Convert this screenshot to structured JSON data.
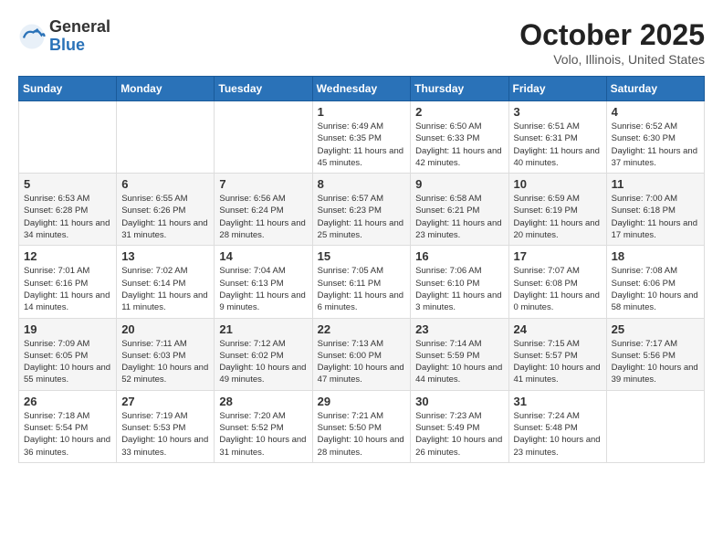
{
  "header": {
    "logo_general": "General",
    "logo_blue": "Blue",
    "month": "October 2025",
    "location": "Volo, Illinois, United States"
  },
  "weekdays": [
    "Sunday",
    "Monday",
    "Tuesday",
    "Wednesday",
    "Thursday",
    "Friday",
    "Saturday"
  ],
  "weeks": [
    [
      {
        "day": "",
        "info": ""
      },
      {
        "day": "",
        "info": ""
      },
      {
        "day": "",
        "info": ""
      },
      {
        "day": "1",
        "info": "Sunrise: 6:49 AM\nSunset: 6:35 PM\nDaylight: 11 hours and 45 minutes."
      },
      {
        "day": "2",
        "info": "Sunrise: 6:50 AM\nSunset: 6:33 PM\nDaylight: 11 hours and 42 minutes."
      },
      {
        "day": "3",
        "info": "Sunrise: 6:51 AM\nSunset: 6:31 PM\nDaylight: 11 hours and 40 minutes."
      },
      {
        "day": "4",
        "info": "Sunrise: 6:52 AM\nSunset: 6:30 PM\nDaylight: 11 hours and 37 minutes."
      }
    ],
    [
      {
        "day": "5",
        "info": "Sunrise: 6:53 AM\nSunset: 6:28 PM\nDaylight: 11 hours and 34 minutes."
      },
      {
        "day": "6",
        "info": "Sunrise: 6:55 AM\nSunset: 6:26 PM\nDaylight: 11 hours and 31 minutes."
      },
      {
        "day": "7",
        "info": "Sunrise: 6:56 AM\nSunset: 6:24 PM\nDaylight: 11 hours and 28 minutes."
      },
      {
        "day": "8",
        "info": "Sunrise: 6:57 AM\nSunset: 6:23 PM\nDaylight: 11 hours and 25 minutes."
      },
      {
        "day": "9",
        "info": "Sunrise: 6:58 AM\nSunset: 6:21 PM\nDaylight: 11 hours and 23 minutes."
      },
      {
        "day": "10",
        "info": "Sunrise: 6:59 AM\nSunset: 6:19 PM\nDaylight: 11 hours and 20 minutes."
      },
      {
        "day": "11",
        "info": "Sunrise: 7:00 AM\nSunset: 6:18 PM\nDaylight: 11 hours and 17 minutes."
      }
    ],
    [
      {
        "day": "12",
        "info": "Sunrise: 7:01 AM\nSunset: 6:16 PM\nDaylight: 11 hours and 14 minutes."
      },
      {
        "day": "13",
        "info": "Sunrise: 7:02 AM\nSunset: 6:14 PM\nDaylight: 11 hours and 11 minutes."
      },
      {
        "day": "14",
        "info": "Sunrise: 7:04 AM\nSunset: 6:13 PM\nDaylight: 11 hours and 9 minutes."
      },
      {
        "day": "15",
        "info": "Sunrise: 7:05 AM\nSunset: 6:11 PM\nDaylight: 11 hours and 6 minutes."
      },
      {
        "day": "16",
        "info": "Sunrise: 7:06 AM\nSunset: 6:10 PM\nDaylight: 11 hours and 3 minutes."
      },
      {
        "day": "17",
        "info": "Sunrise: 7:07 AM\nSunset: 6:08 PM\nDaylight: 11 hours and 0 minutes."
      },
      {
        "day": "18",
        "info": "Sunrise: 7:08 AM\nSunset: 6:06 PM\nDaylight: 10 hours and 58 minutes."
      }
    ],
    [
      {
        "day": "19",
        "info": "Sunrise: 7:09 AM\nSunset: 6:05 PM\nDaylight: 10 hours and 55 minutes."
      },
      {
        "day": "20",
        "info": "Sunrise: 7:11 AM\nSunset: 6:03 PM\nDaylight: 10 hours and 52 minutes."
      },
      {
        "day": "21",
        "info": "Sunrise: 7:12 AM\nSunset: 6:02 PM\nDaylight: 10 hours and 49 minutes."
      },
      {
        "day": "22",
        "info": "Sunrise: 7:13 AM\nSunset: 6:00 PM\nDaylight: 10 hours and 47 minutes."
      },
      {
        "day": "23",
        "info": "Sunrise: 7:14 AM\nSunset: 5:59 PM\nDaylight: 10 hours and 44 minutes."
      },
      {
        "day": "24",
        "info": "Sunrise: 7:15 AM\nSunset: 5:57 PM\nDaylight: 10 hours and 41 minutes."
      },
      {
        "day": "25",
        "info": "Sunrise: 7:17 AM\nSunset: 5:56 PM\nDaylight: 10 hours and 39 minutes."
      }
    ],
    [
      {
        "day": "26",
        "info": "Sunrise: 7:18 AM\nSunset: 5:54 PM\nDaylight: 10 hours and 36 minutes."
      },
      {
        "day": "27",
        "info": "Sunrise: 7:19 AM\nSunset: 5:53 PM\nDaylight: 10 hours and 33 minutes."
      },
      {
        "day": "28",
        "info": "Sunrise: 7:20 AM\nSunset: 5:52 PM\nDaylight: 10 hours and 31 minutes."
      },
      {
        "day": "29",
        "info": "Sunrise: 7:21 AM\nSunset: 5:50 PM\nDaylight: 10 hours and 28 minutes."
      },
      {
        "day": "30",
        "info": "Sunrise: 7:23 AM\nSunset: 5:49 PM\nDaylight: 10 hours and 26 minutes."
      },
      {
        "day": "31",
        "info": "Sunrise: 7:24 AM\nSunset: 5:48 PM\nDaylight: 10 hours and 23 minutes."
      },
      {
        "day": "",
        "info": ""
      }
    ]
  ]
}
